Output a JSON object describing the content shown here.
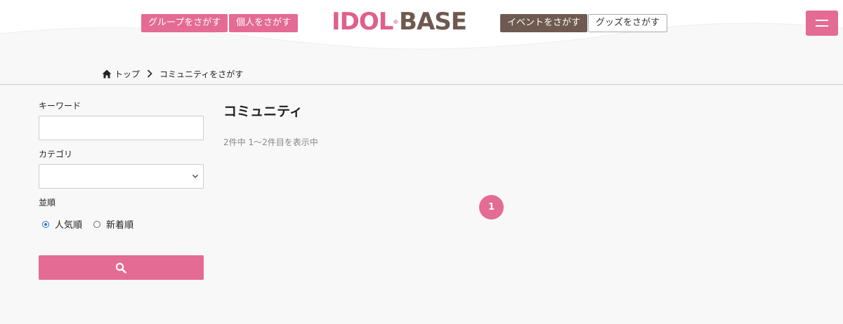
{
  "header": {
    "nav_left": [
      "グループをさがす",
      "個人をさがす"
    ],
    "nav_right": [
      "イベントをさがす",
      "グッズをさがす"
    ],
    "logo_text_left": "IDOL",
    "logo_text_right": "BASE",
    "colors": {
      "pink": "#e46b93",
      "brown": "#6e5a50"
    },
    "menu_icon": "hamburger-icon"
  },
  "breadcrumb": {
    "home": "トップ",
    "current": "コミュニティをさがす"
  },
  "sidebar": {
    "keyword_label": "キーワード",
    "keyword_value": "",
    "category_label": "カテゴリ",
    "category_value": "",
    "sort_label": "並順",
    "sort_options": [
      "人気順",
      "新着順"
    ],
    "sort_selected": "人気順",
    "search_icon": "search-icon"
  },
  "main": {
    "title": "コミュニティ",
    "count_text": "2件中 1〜2件目を表示中",
    "pagination": [
      "1"
    ]
  }
}
